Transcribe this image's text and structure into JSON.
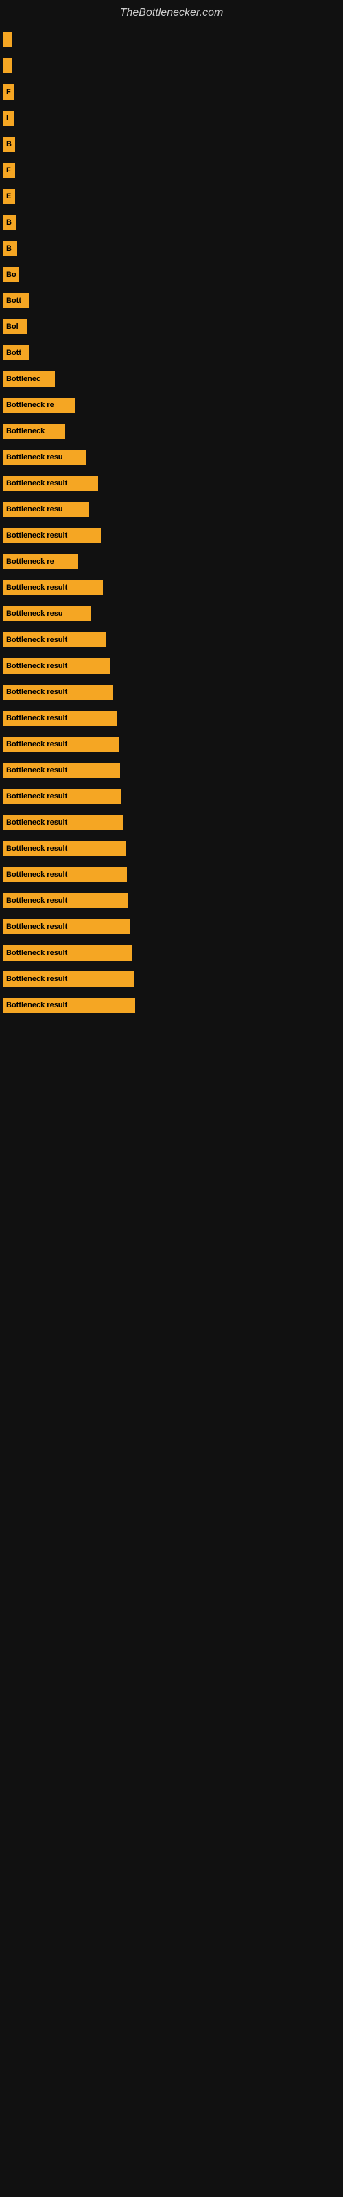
{
  "site_title": "TheBottlenecker.com",
  "bars": [
    {
      "label": "",
      "width": 12
    },
    {
      "label": "",
      "width": 12
    },
    {
      "label": "F",
      "width": 15
    },
    {
      "label": "I",
      "width": 15
    },
    {
      "label": "B",
      "width": 17
    },
    {
      "label": "F",
      "width": 17
    },
    {
      "label": "E",
      "width": 17
    },
    {
      "label": "B",
      "width": 19
    },
    {
      "label": "B",
      "width": 20
    },
    {
      "label": "Bo",
      "width": 22
    },
    {
      "label": "Bott",
      "width": 37
    },
    {
      "label": "Bol",
      "width": 35
    },
    {
      "label": "Bott",
      "width": 38
    },
    {
      "label": "Bottlenec",
      "width": 75
    },
    {
      "label": "Bottleneck re",
      "width": 105
    },
    {
      "label": "Bottleneck",
      "width": 90
    },
    {
      "label": "Bottleneck resu",
      "width": 120
    },
    {
      "label": "Bottleneck result",
      "width": 138
    },
    {
      "label": "Bottleneck resu",
      "width": 125
    },
    {
      "label": "Bottleneck result",
      "width": 142
    },
    {
      "label": "Bottleneck re",
      "width": 108
    },
    {
      "label": "Bottleneck result",
      "width": 145
    },
    {
      "label": "Bottleneck resu",
      "width": 128
    },
    {
      "label": "Bottleneck result",
      "width": 150
    },
    {
      "label": "Bottleneck result",
      "width": 155
    },
    {
      "label": "Bottleneck result",
      "width": 160
    },
    {
      "label": "Bottleneck result",
      "width": 165
    },
    {
      "label": "Bottleneck result",
      "width": 168
    },
    {
      "label": "Bottleneck result",
      "width": 170
    },
    {
      "label": "Bottleneck result",
      "width": 172
    },
    {
      "label": "Bottleneck result",
      "width": 175
    },
    {
      "label": "Bottleneck result",
      "width": 178
    },
    {
      "label": "Bottleneck result",
      "width": 180
    },
    {
      "label": "Bottleneck result",
      "width": 182
    },
    {
      "label": "Bottleneck result",
      "width": 185
    },
    {
      "label": "Bottleneck result",
      "width": 187
    },
    {
      "label": "Bottleneck result",
      "width": 190
    },
    {
      "label": "Bottleneck result",
      "width": 192
    }
  ]
}
